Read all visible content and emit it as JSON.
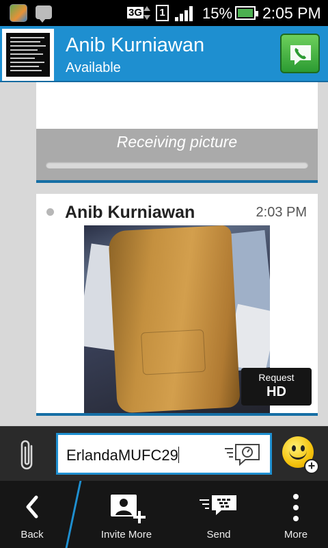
{
  "status_bar": {
    "network": "3G",
    "sim": "1",
    "battery_percent": "15%",
    "time": "2:05 PM"
  },
  "header": {
    "contact_name": "Anib Kurniawan",
    "contact_status": "Available"
  },
  "messages": [
    {
      "type": "picture-transfer",
      "status_text": "Receiving picture",
      "progress": 0
    },
    {
      "type": "picture",
      "sender": "Anib Kurniawan",
      "time": "2:03 PM",
      "request_hd_line1": "Request",
      "request_hd_line2": "HD"
    }
  ],
  "compose": {
    "input_value": "ErlandaMUFC29"
  },
  "bottom_bar": {
    "back_label": "Back",
    "invite_label": "Invite More",
    "send_label": "Send",
    "more_label": "More"
  },
  "colors": {
    "header_bg": "#1e8fd0",
    "accent": "#166fa5",
    "call_green": "#2c9b32"
  }
}
